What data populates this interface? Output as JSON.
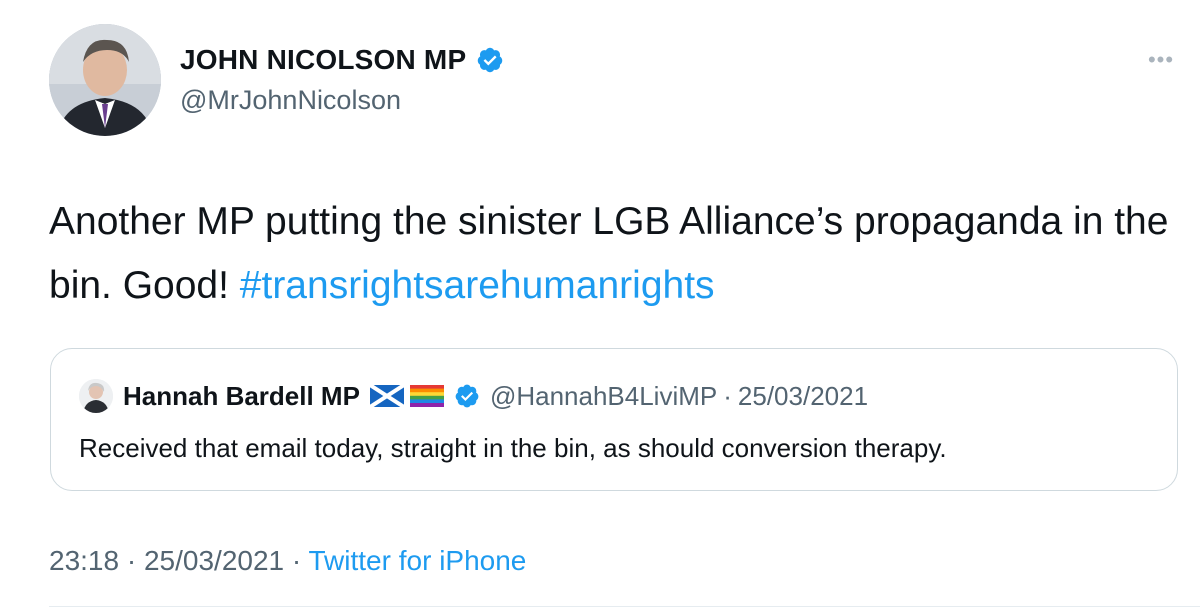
{
  "author": {
    "name": "JOHN NICOLSON MP",
    "handle": "@MrJohnNicolson",
    "avatar_icon": "person-photo-avatar",
    "verified_icon": "verified-badge-icon"
  },
  "more_icon": "more-options-icon",
  "tweet": {
    "text": "Another MP putting the sinister LGB Alliance’s propaganda in the bin. Good! ",
    "hashtag": "#transrightsarehumanrights"
  },
  "quote": {
    "name": "Hannah Bardell MP",
    "flags": [
      "scotland-flag-icon",
      "rainbow-flag-icon"
    ],
    "handle": "@HannahB4LiviMP",
    "separator": "·",
    "date": "25/03/2021",
    "text": "Received that email today, straight in the bin, as should conversion therapy."
  },
  "meta": {
    "time": "23:18",
    "separator": " · ",
    "date": "25/03/2021",
    "separator2": " · ",
    "source": "Twitter for iPhone"
  },
  "colors": {
    "accent": "#1d9bf0",
    "secondary_text": "#536471",
    "border": "#cfd9de"
  }
}
